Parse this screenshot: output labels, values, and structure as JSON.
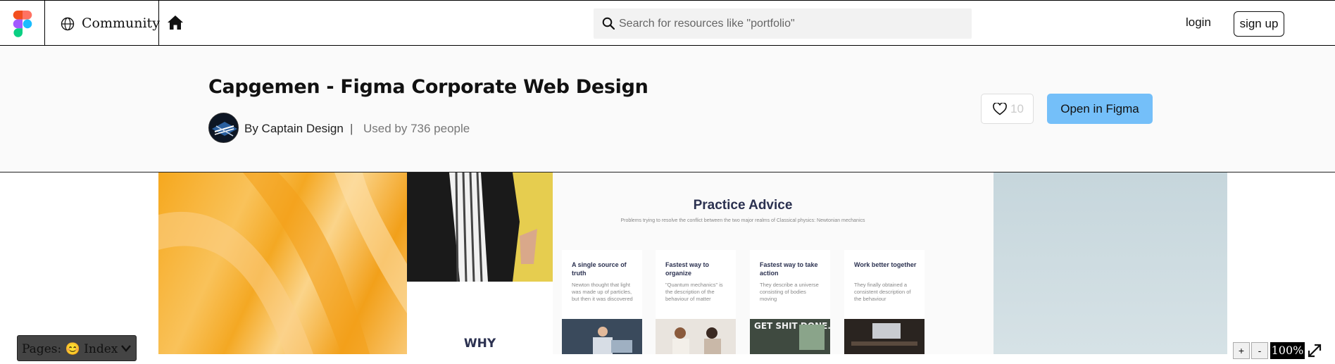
{
  "topbar": {
    "community_label": "Community",
    "search_placeholder": "Search for resources like \"portfolio\"",
    "login_label": "login",
    "signup_label": "sign up"
  },
  "file": {
    "title": "Capgemen - Figma Corporate Web Design",
    "author": "By Captain Design",
    "separator": "|",
    "usage": "Used by 736 people",
    "like_count": "10",
    "open_label": "Open in Figma"
  },
  "preview": {
    "why_text": "WHY",
    "advice_title": "Practice Advice",
    "advice_subtitle": "Problems trying to resolve the conflict between the two major realms of Classical physics: Newtonian mechanics",
    "cards": [
      {
        "title": "A single source of truth",
        "body": "Newton thought that light was made up of particles, but then it was discovered"
      },
      {
        "title": "Fastest way to organize",
        "body": "\"Quantum mechanics\" is the description of the behaviour of matter"
      },
      {
        "title": "Fastest way to take action",
        "body": "They describe a universe consisting of bodies moving"
      },
      {
        "title": "Work better together",
        "body": "They finally obtained a consistent description of the behaviour"
      }
    ],
    "card_poster_text": "GET SHIT DONE."
  },
  "controls": {
    "pages_label": "Pages: 😊 Index",
    "zoom_in": "+",
    "zoom_out": "-",
    "zoom_value": "100%"
  },
  "colors": {
    "open_button": "#74bff9",
    "header_band": "#fafafa",
    "preview_accent": "#f6a81e",
    "heading_navy": "#2b3150"
  },
  "icons": [
    "figma-logo-icon",
    "globe-icon",
    "home-icon",
    "search-icon",
    "heart-icon",
    "chevron-down-icon",
    "expand-icon"
  ]
}
